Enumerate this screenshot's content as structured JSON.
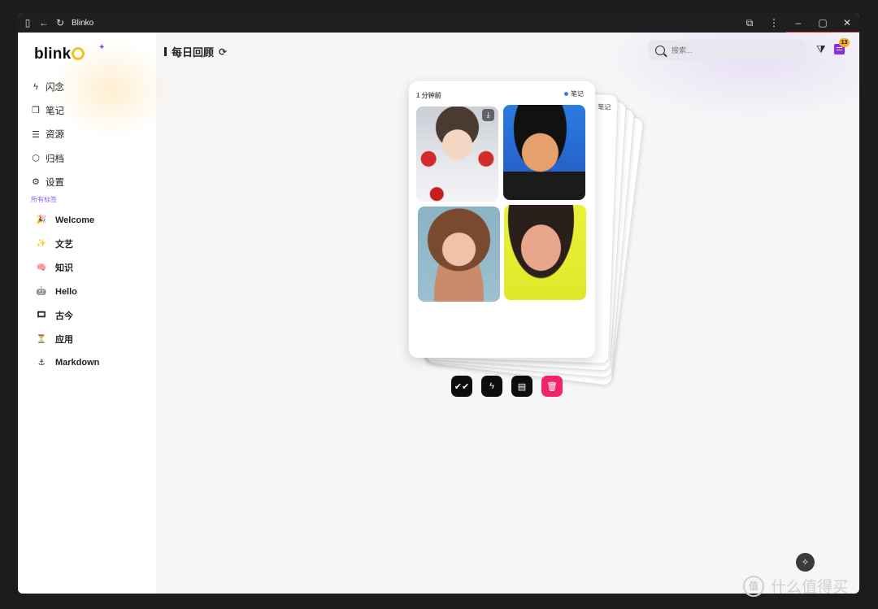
{
  "window": {
    "title": "Blinko"
  },
  "sidebar": {
    "logo": {
      "text": "blink"
    },
    "nav": [
      {
        "label": "闪念",
        "icon": "lightning-icon"
      },
      {
        "label": "笔记",
        "icon": "notebook-icon"
      },
      {
        "label": "资源",
        "icon": "database-icon"
      },
      {
        "label": "归档",
        "icon": "box-icon"
      },
      {
        "label": "设置",
        "icon": "gear-icon"
      }
    ],
    "tags_label": "所有标签",
    "tags": [
      {
        "label": "Welcome",
        "emoji": "🎉"
      },
      {
        "label": "文艺",
        "emoji": "✨"
      },
      {
        "label": "知识",
        "emoji": "🧠"
      },
      {
        "label": "Hello",
        "emoji": "🤖"
      },
      {
        "label": "古今",
        "emoji": "🎞"
      },
      {
        "label": "应用",
        "emoji": "⏳"
      },
      {
        "label": "Markdown",
        "emoji": "⚓"
      }
    ]
  },
  "header": {
    "title": "每日回顾",
    "search_placeholder": "搜索...",
    "badge_count": "13"
  },
  "card": {
    "time": "1 分钟前",
    "type": "笔记",
    "back_label": "笔记"
  },
  "colors": {
    "accent_purple": "#8b2be2",
    "delete_pink": "#f0246a",
    "badge_orange": "#f5a623",
    "logo_yellow": "#f4c21a"
  },
  "watermark": {
    "text": "什么值得买",
    "icon_text": "值"
  }
}
